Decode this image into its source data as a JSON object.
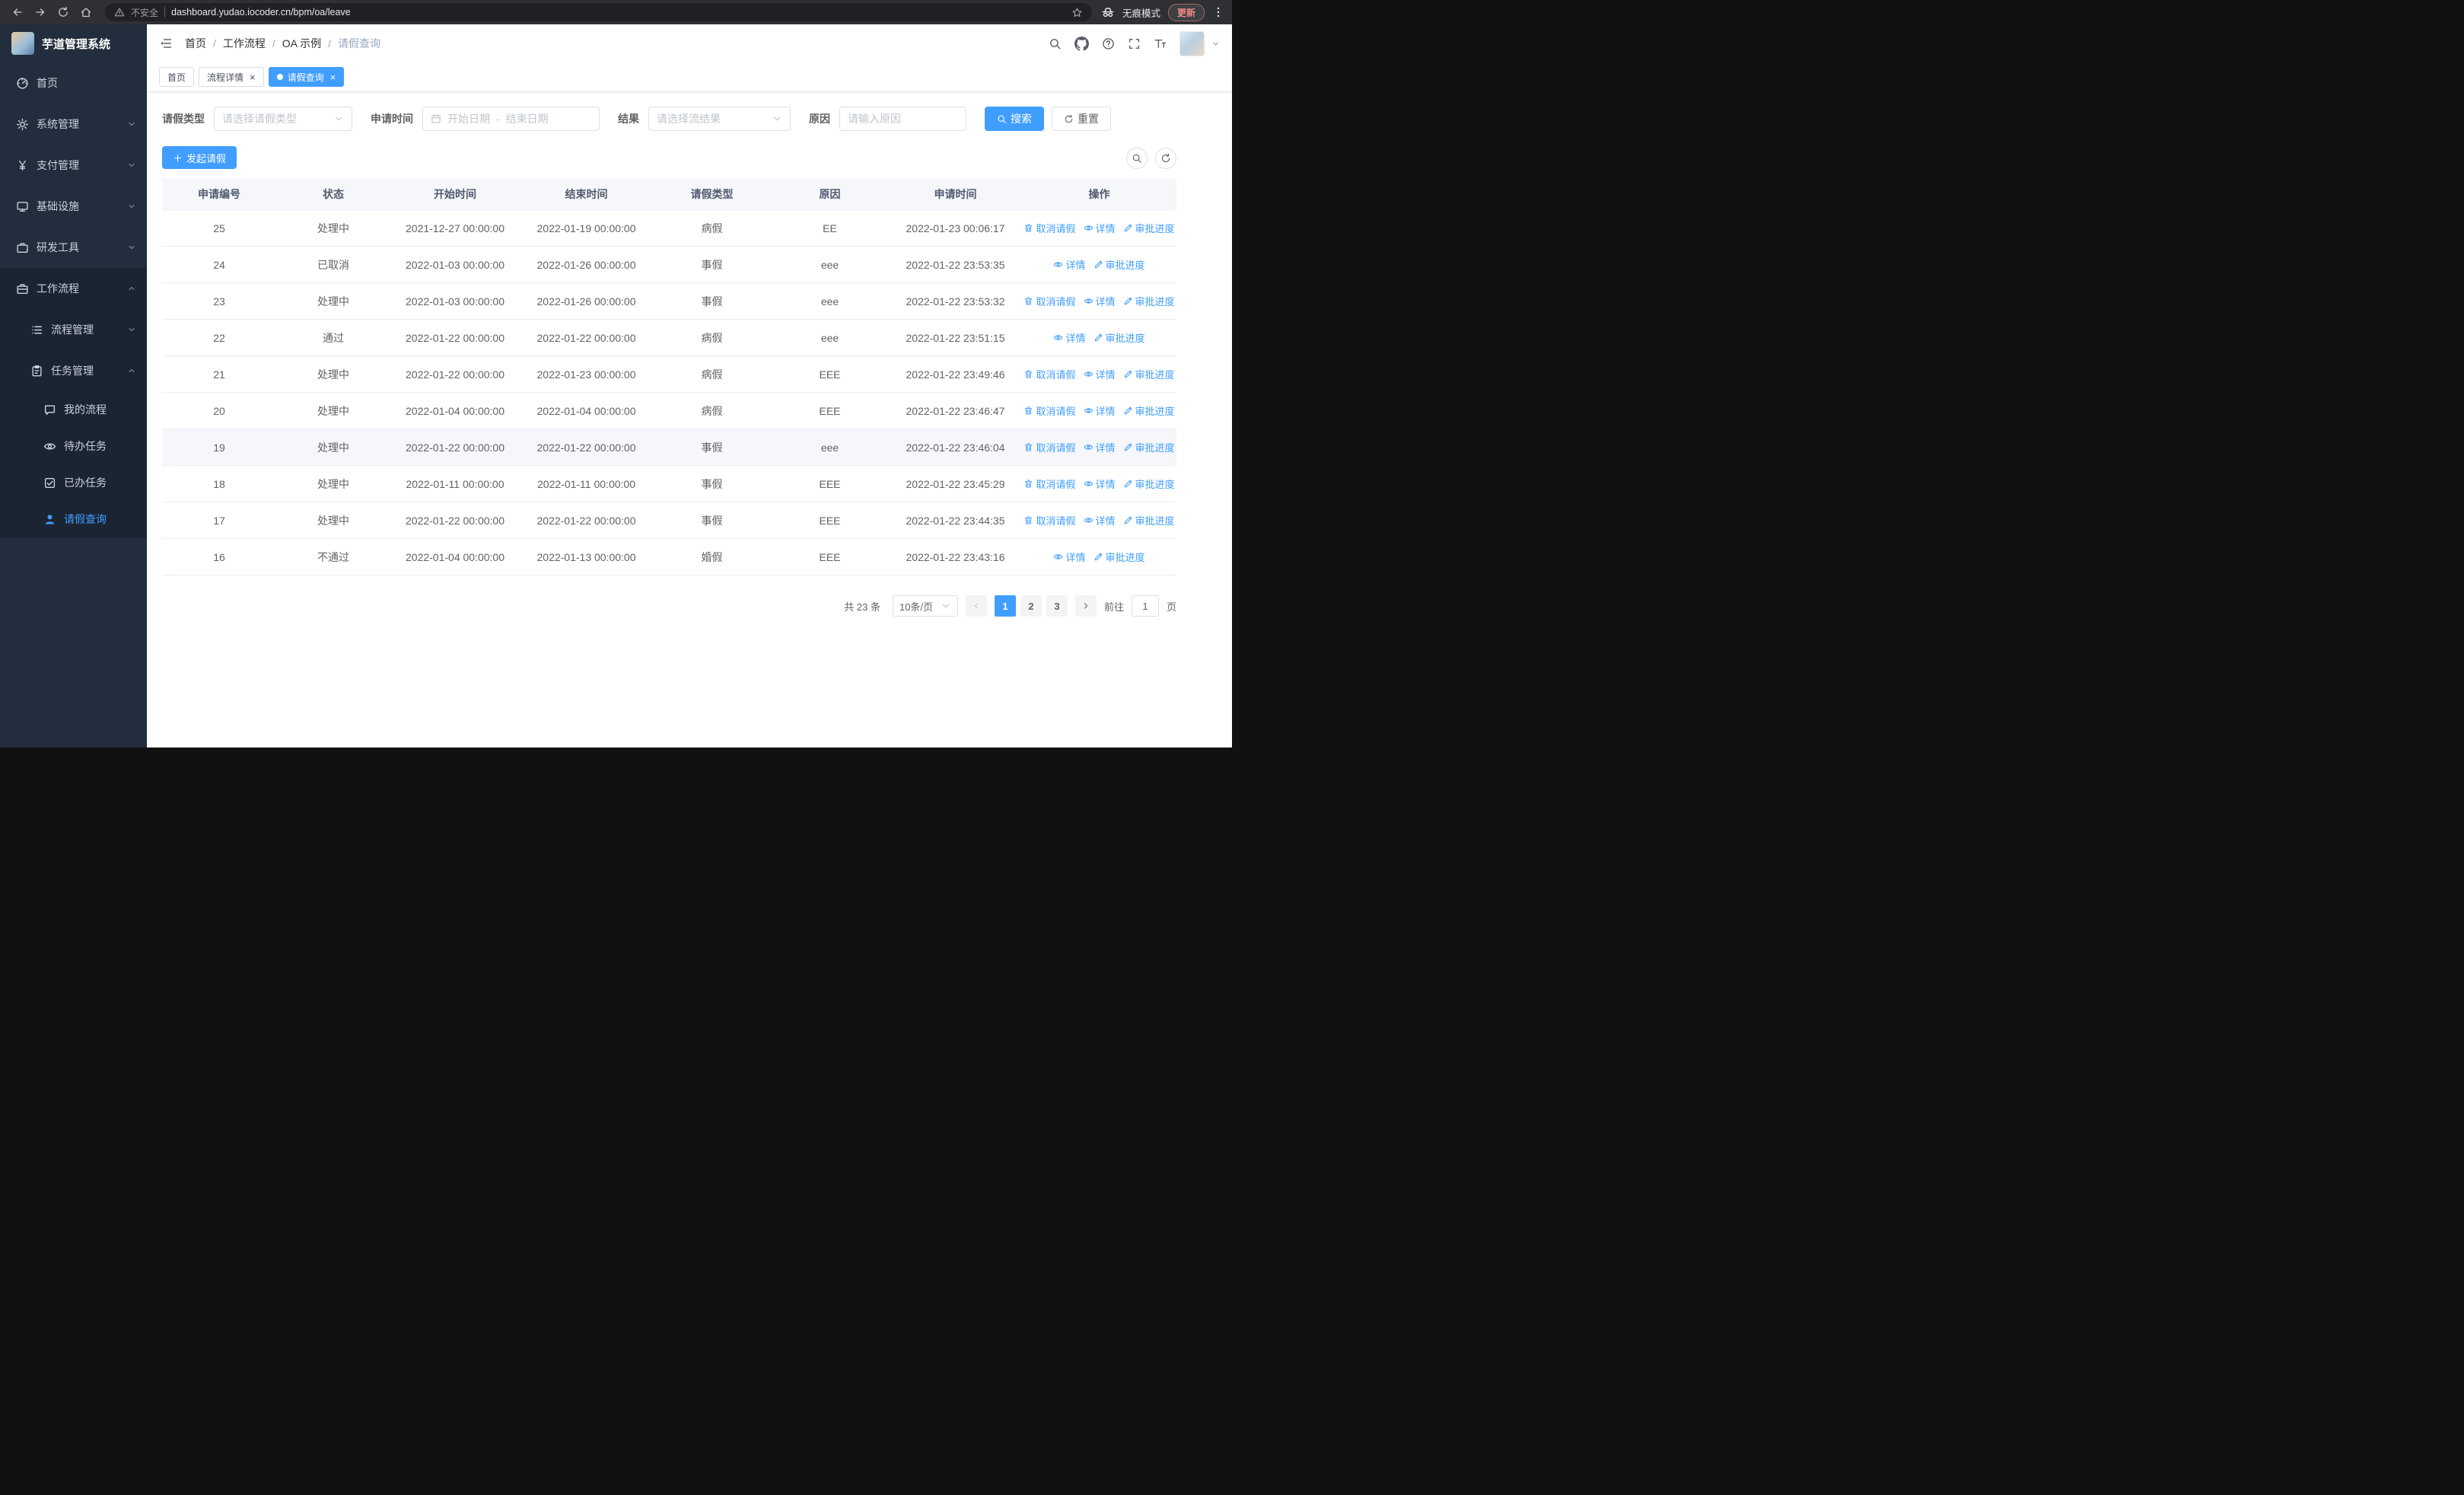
{
  "browser": {
    "security_label": "不安全",
    "url": "dashboard.yudao.iocoder.cn/bpm/oa/leave",
    "incognito_label": "无痕模式",
    "update_label": "更新"
  },
  "sidebar": {
    "logo_title": "芋道管理系统",
    "items": [
      {
        "key": "home",
        "label": "首页",
        "icon": "dashboard-icon",
        "level": 1
      },
      {
        "key": "system-management",
        "label": "系统管理",
        "icon": "gear-icon",
        "level": 1,
        "chevron": "down"
      },
      {
        "key": "payment-management",
        "label": "支付管理",
        "icon": "yen-icon",
        "level": 1,
        "chevron": "down"
      },
      {
        "key": "infrastructure",
        "label": "基础设施",
        "icon": "infra-icon",
        "level": 1,
        "chevron": "down"
      },
      {
        "key": "dev-tools",
        "label": "研发工具",
        "icon": "tools-icon",
        "level": 1,
        "chevron": "down"
      },
      {
        "key": "workflow",
        "label": "工作流程",
        "icon": "workflow-icon",
        "level": 1,
        "chevron": "up",
        "expanded": true
      },
      {
        "key": "process-management",
        "label": "流程管理",
        "icon": "process-icon",
        "level": 2,
        "chevron": "down",
        "in_expanded": true
      },
      {
        "key": "task-management",
        "label": "任务管理",
        "icon": "task-icon",
        "level": 2,
        "chevron": "up",
        "in_expanded": true
      },
      {
        "key": "my-process",
        "label": "我的流程",
        "icon": "message-icon",
        "level": 3,
        "in_expanded": true
      },
      {
        "key": "todo-tasks",
        "label": "待办任务",
        "icon": "eye-icon",
        "level": 3,
        "in_expanded": true
      },
      {
        "key": "done-tasks",
        "label": "已办任务",
        "icon": "check-icon",
        "level": 3,
        "in_expanded": true
      },
      {
        "key": "leave-query",
        "label": "请假查询",
        "icon": "user-icon",
        "level": 3,
        "active": true,
        "in_expanded": true
      }
    ]
  },
  "header": {
    "breadcrumb": [
      "首页",
      "工作流程",
      "OA 示例",
      "请假查询"
    ]
  },
  "tabs": [
    {
      "key": "home",
      "label": "首页",
      "closable": false,
      "active": false
    },
    {
      "key": "process-detail",
      "label": "流程详情",
      "closable": true,
      "active": false
    },
    {
      "key": "leave-query",
      "label": "请假查询",
      "closable": true,
      "active": true
    }
  ],
  "filters": {
    "leave_type": {
      "label": "请假类型",
      "placeholder": "请选择请假类型"
    },
    "apply_time": {
      "label": "申请时间",
      "start_placeholder": "开始日期",
      "separator": "-",
      "end_placeholder": "结束日期"
    },
    "result": {
      "label": "结果",
      "placeholder": "请选择流结果"
    },
    "reason": {
      "label": "原因",
      "placeholder": "请输入原因"
    },
    "search_label": "搜索",
    "reset_label": "重置"
  },
  "toolbar": {
    "create_label": "发起请假"
  },
  "table": {
    "columns": [
      "申请编号",
      "状态",
      "开始时间",
      "结束时间",
      "请假类型",
      "原因",
      "申请时间",
      "操作"
    ],
    "action_labels": {
      "cancel": "取消请假",
      "detail": "详情",
      "progress": "审批进度"
    },
    "rows": [
      {
        "seq": "25",
        "status": "处理中",
        "start_time": "2021-12-27 00:00:00",
        "end_time": "2022-01-19 00:00:00",
        "leave_type": "病假",
        "reason": "EE",
        "apply_time": "2022-01-23 00:06:17",
        "actions": [
          "cancel",
          "detail",
          "progress"
        ]
      },
      {
        "seq": "24",
        "status": "已取消",
        "start_time": "2022-01-03 00:00:00",
        "end_time": "2022-01-26 00:00:00",
        "leave_type": "事假",
        "reason": "eee",
        "apply_time": "2022-01-22 23:53:35",
        "actions": [
          "detail",
          "progress"
        ]
      },
      {
        "seq": "23",
        "status": "处理中",
        "start_time": "2022-01-03 00:00:00",
        "end_time": "2022-01-26 00:00:00",
        "leave_type": "事假",
        "reason": "eee",
        "apply_time": "2022-01-22 23:53:32",
        "actions": [
          "cancel",
          "detail",
          "progress"
        ]
      },
      {
        "seq": "22",
        "status": "通过",
        "start_time": "2022-01-22 00:00:00",
        "end_time": "2022-01-22 00:00:00",
        "leave_type": "病假",
        "reason": "eee",
        "apply_time": "2022-01-22 23:51:15",
        "actions": [
          "detail",
          "progress"
        ]
      },
      {
        "seq": "21",
        "status": "处理中",
        "start_time": "2022-01-22 00:00:00",
        "end_time": "2022-01-23 00:00:00",
        "leave_type": "病假",
        "reason": "EEE",
        "apply_time": "2022-01-22 23:49:46",
        "actions": [
          "cancel",
          "detail",
          "progress"
        ]
      },
      {
        "seq": "20",
        "status": "处理中",
        "start_time": "2022-01-04 00:00:00",
        "end_time": "2022-01-04 00:00:00",
        "leave_type": "病假",
        "reason": "EEE",
        "apply_time": "2022-01-22 23:46:47",
        "actions": [
          "cancel",
          "detail",
          "progress"
        ]
      },
      {
        "seq": "19",
        "status": "处理中",
        "start_time": "2022-01-22 00:00:00",
        "end_time": "2022-01-22 00:00:00",
        "leave_type": "事假",
        "reason": "eee",
        "apply_time": "2022-01-22 23:46:04",
        "actions": [
          "cancel",
          "detail",
          "progress"
        ],
        "highlight": true
      },
      {
        "seq": "18",
        "status": "处理中",
        "start_time": "2022-01-11 00:00:00",
        "end_time": "2022-01-11 00:00:00",
        "leave_type": "事假",
        "reason": "EEE",
        "apply_time": "2022-01-22 23:45:29",
        "actions": [
          "cancel",
          "detail",
          "progress"
        ]
      },
      {
        "seq": "17",
        "status": "处理中",
        "start_time": "2022-01-22 00:00:00",
        "end_time": "2022-01-22 00:00:00",
        "leave_type": "事假",
        "reason": "EEE",
        "apply_time": "2022-01-22 23:44:35",
        "actions": [
          "cancel",
          "detail",
          "progress"
        ]
      },
      {
        "seq": "16",
        "status": "不通过",
        "start_time": "2022-01-04 00:00:00",
        "end_time": "2022-01-13 00:00:00",
        "leave_type": "婚假",
        "reason": "EEE",
        "apply_time": "2022-01-22 23:43:16",
        "actions": [
          "detail",
          "progress"
        ]
      }
    ]
  },
  "pagination": {
    "total_text": "共 23 条",
    "page_size": "10条/页",
    "pages": [
      "1",
      "2",
      "3"
    ],
    "active_page": "1",
    "goto_label": "前往",
    "goto_value": "1",
    "goto_suffix": "页"
  },
  "colors": {
    "accent": "#409eff",
    "link": "#409eff",
    "sidebar_bg": "#222d3d",
    "sidebar_dark": "#1b2433",
    "table_header_bg": "#f5f7fa",
    "update_red": "#f28b82"
  }
}
